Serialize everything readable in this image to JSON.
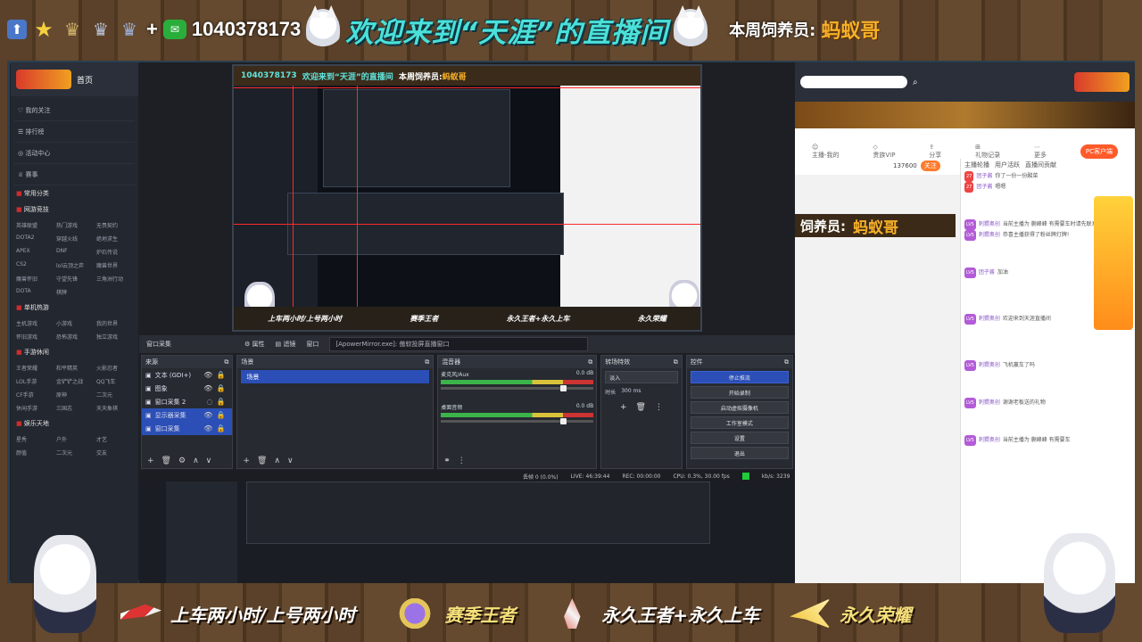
{
  "top": {
    "qq_number": "1040378173",
    "welcome": "欢迎来到“天涯”的直播间",
    "feeder_label": "本周饲养员:",
    "feeder_name": "蚂蚁哥"
  },
  "left_site": {
    "home": "首页",
    "menu": [
      "我的关注",
      "排行榜",
      "活动中心",
      "赛事"
    ],
    "sections": [
      {
        "title": "常用分类",
        "items": []
      },
      {
        "title": "网游竞技",
        "items": [
          "英雄联盟",
          "热门游戏",
          "无畏契约",
          "DOTA2",
          "穿越火线",
          "绝地求生",
          "APEX",
          "DNF",
          "炉石传说",
          "CS2",
          "lol云顶之弈",
          "魔兽世界",
          "魔兽怀旧",
          "守望先锋",
          "三角洲行动",
          "DOTA",
          "棋牌"
        ]
      },
      {
        "title": "单机热游",
        "items": [
          "主机游戏",
          "小游戏",
          "我的世界",
          "怀旧游戏",
          "恐怖游戏",
          "独立游戏"
        ]
      },
      {
        "title": "手游休闲",
        "items": [
          "王者荣耀",
          "和平精英",
          "火影忍者",
          "LOL手游",
          "金铲铲之战",
          "QQ飞车",
          "CF手游",
          "原神",
          "二次元",
          "休闲手游",
          "三国志",
          "天天象棋"
        ]
      },
      {
        "title": "娱乐天地",
        "items": [
          "星秀",
          "户外",
          "才艺",
          "颜值",
          "二次元",
          "交友"
        ]
      }
    ]
  },
  "obs": {
    "toolbar": {
      "window_capture": "窗口采集",
      "properties": "属性",
      "filters": "滤镜",
      "window": "窗口",
      "window_value": "[ApowerMirror.exe]: 傲软投屏直播窗口"
    },
    "docks": {
      "sources": "来源",
      "scenes": "场景",
      "mixer": "混音器",
      "transitions": "转场特效",
      "controls": "控件"
    },
    "sources": [
      {
        "name": "文本 (GDI+)",
        "selected": false
      },
      {
        "name": "图象",
        "selected": false
      },
      {
        "name": "窗口采集 2",
        "selected": false
      },
      {
        "name": "显示器采集",
        "selected": true
      },
      {
        "name": "窗口采集",
        "selected": true
      }
    ],
    "scene": "场景",
    "mixer": [
      {
        "name": "麦克风/Aux",
        "db": "0.0 dB"
      },
      {
        "name": "桌面音频",
        "db": "0.0 dB"
      }
    ],
    "transition": {
      "type": "淡入",
      "duration_label": "时长",
      "duration": "300 ms"
    },
    "controls": [
      "停止推流",
      "开始录制",
      "启动虚拟摄像机",
      "工作室模式",
      "设置",
      "退出"
    ],
    "status": {
      "dropped": "丢帧 0 (0.0%)",
      "live": "LIVE: 46:39:44",
      "rec": "REC: 00:00:00",
      "cpu": "CPU: 0.3%, 30.00 fps",
      "kbps": "kb/s: 3239"
    }
  },
  "right_site": {
    "pc_button": "PC客户端",
    "icons": [
      "主播-我的",
      "贵族VIP",
      "分享",
      "礼物记录",
      "更多"
    ],
    "feeder_label": "饲养员:",
    "feeder_name": "蚂蚁哥",
    "follow_count": "137600",
    "follow": "关注",
    "chat_tabs": [
      "主播轮播",
      "用户活跃",
      "直播间贡献"
    ],
    "chat": [
      {
        "level": "27",
        "user": "团子酱",
        "text": "你了一份一份酸菜"
      },
      {
        "level": "27",
        "user": "团子酱",
        "text": "嗯嗯"
      },
      {
        "level": "LV5",
        "user": "刺猬奥创",
        "text": "当前主播为 蒯峰峰 有需要车时请先联系"
      },
      {
        "level": "LV5",
        "user": "刺猬奥创",
        "text": "恭喜主播获得了粉丝牌灯牌!"
      },
      {
        "level": "LV5",
        "user": "团子酱",
        "text": "加油"
      },
      {
        "level": "LV5",
        "user": "刺猬奥创",
        "text": "欢迎来到天涯直播间"
      },
      {
        "level": "LV5",
        "user": "刺猬奥创",
        "text": "飞机赢车了吗"
      },
      {
        "level": "LV5",
        "user": "刺猬奥创",
        "text": "谢谢老板送的礼物"
      },
      {
        "level": "LV5",
        "user": "刺猬奥创",
        "text": "当前主播为 蒯峰峰 有需要车"
      }
    ]
  },
  "bottom": {
    "items": [
      "上车两小时/上号两小时",
      "赛季王者",
      "永久王者+永久上车",
      "永久荣耀"
    ]
  }
}
